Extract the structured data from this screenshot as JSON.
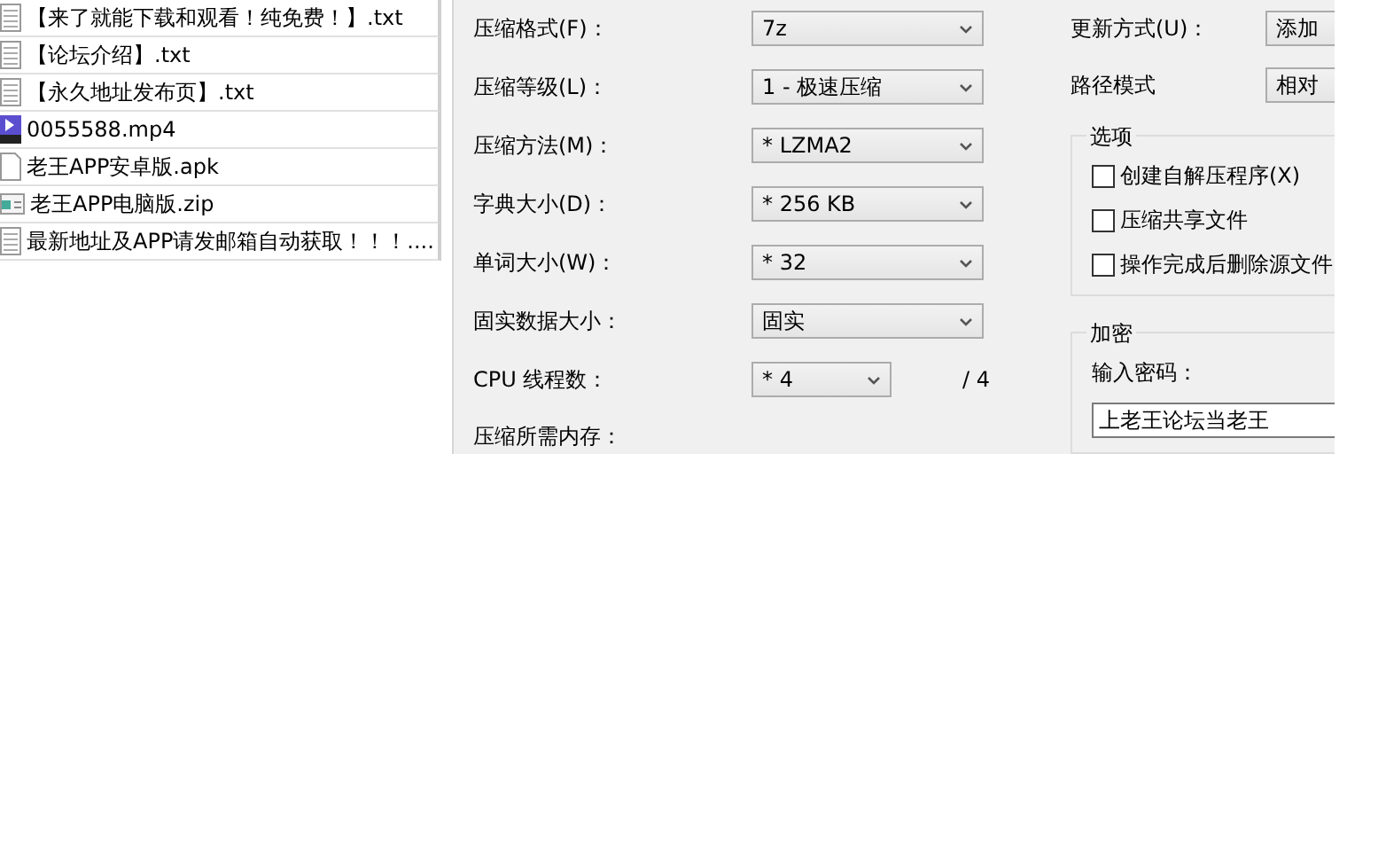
{
  "files": [
    {
      "name": "【来了就能下载和观看！纯免费！】.txt",
      "kind": "text"
    },
    {
      "name": "【论坛介绍】.txt",
      "kind": "text"
    },
    {
      "name": "【永久地址发布页】.txt",
      "kind": "text"
    },
    {
      "name": "0055588.mp4",
      "kind": "video"
    },
    {
      "name": "老王APP安卓版.apk",
      "kind": "blank"
    },
    {
      "name": "老王APP电脑版.zip",
      "kind": "archive"
    },
    {
      "name": "最新地址及APP请发邮箱自动获取！！！....",
      "kind": "text"
    }
  ],
  "settings": [
    {
      "label": "压缩格式(F)：",
      "value": "7z"
    },
    {
      "label": "压缩等级(L)：",
      "value": "1 - 极速压缩"
    },
    {
      "label": "压缩方法(M)：",
      "value": "* LZMA2"
    },
    {
      "label": "字典大小(D)：",
      "value": "* 256 KB"
    },
    {
      "label": "单词大小(W)：",
      "value": "* 32"
    },
    {
      "label": "固实数据大小：",
      "value": "固实"
    }
  ],
  "threads": {
    "label": "CPU 线程数：",
    "value": "* 4",
    "total": "/ 4"
  },
  "memory_label": "压缩所需内存：",
  "update_mode": {
    "label": "更新方式(U)：",
    "value": "添加"
  },
  "path_mode": {
    "label": "路径模式",
    "value": "相对"
  },
  "options": {
    "title": "选项",
    "items": [
      {
        "label": "创建自解压程序(X)",
        "checked": false
      },
      {
        "label": "压缩共享文件",
        "checked": false
      },
      {
        "label": "操作完成后删除源文件",
        "checked": false
      }
    ]
  },
  "encryption": {
    "title": "加密",
    "password_label": "输入密码：",
    "password": "上老王论坛当老王"
  }
}
